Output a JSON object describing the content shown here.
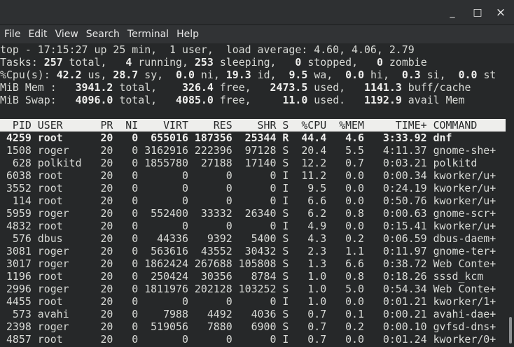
{
  "window": {
    "controls": {
      "minimize": "_",
      "maximize": "□",
      "close": "×"
    }
  },
  "menu": [
    "File",
    "Edit",
    "View",
    "Search",
    "Terminal",
    "Help"
  ],
  "summary": [
    [
      {
        "t": "top - 17:15:27 up 25 min,  1 user,  load average: 4.60, 4.06, 2.79",
        "b": false
      }
    ],
    [
      {
        "t": "Tasks: "
      },
      {
        "t": "257",
        "b": true
      },
      {
        "t": " total,   "
      },
      {
        "t": "4",
        "b": true
      },
      {
        "t": " running, "
      },
      {
        "t": "253",
        "b": true
      },
      {
        "t": " sleeping,   "
      },
      {
        "t": "0",
        "b": true
      },
      {
        "t": " stopped,   "
      },
      {
        "t": "0",
        "b": true
      },
      {
        "t": " zombie"
      }
    ],
    [
      {
        "t": "%Cpu(s): "
      },
      {
        "t": "42.2",
        "b": true
      },
      {
        "t": " us, "
      },
      {
        "t": "28.7",
        "b": true
      },
      {
        "t": " sy,  "
      },
      {
        "t": "0.0",
        "b": true
      },
      {
        "t": " ni, "
      },
      {
        "t": "19.3",
        "b": true
      },
      {
        "t": " id,  "
      },
      {
        "t": "9.5",
        "b": true
      },
      {
        "t": " wa,  "
      },
      {
        "t": "0.0",
        "b": true
      },
      {
        "t": " hi,  "
      },
      {
        "t": "0.3",
        "b": true
      },
      {
        "t": " si,  "
      },
      {
        "t": "0.0",
        "b": true
      },
      {
        "t": " st"
      }
    ],
    [
      {
        "t": "MiB Mem :   "
      },
      {
        "t": "3941.2",
        "b": true
      },
      {
        "t": " total,    "
      },
      {
        "t": "326.4",
        "b": true
      },
      {
        "t": " free,   "
      },
      {
        "t": "2473.5",
        "b": true
      },
      {
        "t": " used,   "
      },
      {
        "t": "1141.3",
        "b": true
      },
      {
        "t": " buff/cache"
      }
    ],
    [
      {
        "t": "MiB Swap:   "
      },
      {
        "t": "4096.0",
        "b": true
      },
      {
        "t": " total,   "
      },
      {
        "t": "4085.0",
        "b": true
      },
      {
        "t": " free,     "
      },
      {
        "t": "11.0",
        "b": true
      },
      {
        "t": " used.   "
      },
      {
        "t": "1192.9",
        "b": true
      },
      {
        "t": " avail Mem"
      }
    ]
  ],
  "columns": [
    "PID",
    "USER",
    "PR",
    "NI",
    "VIRT",
    "RES",
    "SHR",
    "S",
    "%CPU",
    "%MEM",
    "TIME+",
    "COMMAND"
  ],
  "processes": [
    [
      "4259",
      "root",
      "20",
      "0",
      "655016",
      "187356",
      "25344",
      "R",
      "44.4",
      "4.6",
      "3:33.92",
      "dnf",
      true
    ],
    [
      "1508",
      "roger",
      "20",
      "0",
      "3162916",
      "222396",
      "97128",
      "S",
      "20.4",
      "5.5",
      "4:11.37",
      "gnome-she+"
    ],
    [
      "628",
      "polkitd",
      "20",
      "0",
      "1855780",
      "27188",
      "17140",
      "S",
      "12.2",
      "0.7",
      "0:03.21",
      "polkitd"
    ],
    [
      "6038",
      "root",
      "20",
      "0",
      "0",
      "0",
      "0",
      "I",
      "11.2",
      "0.0",
      "0:00.34",
      "kworker/u+"
    ],
    [
      "3552",
      "root",
      "20",
      "0",
      "0",
      "0",
      "0",
      "I",
      "9.5",
      "0.0",
      "0:24.19",
      "kworker/u+"
    ],
    [
      "114",
      "root",
      "20",
      "0",
      "0",
      "0",
      "0",
      "I",
      "6.6",
      "0.0",
      "0:50.76",
      "kworker/u+"
    ],
    [
      "5959",
      "roger",
      "20",
      "0",
      "552400",
      "33332",
      "26340",
      "S",
      "6.2",
      "0.8",
      "0:00.63",
      "gnome-scr+"
    ],
    [
      "4832",
      "root",
      "20",
      "0",
      "0",
      "0",
      "0",
      "I",
      "4.9",
      "0.0",
      "0:15.41",
      "kworker/u+"
    ],
    [
      "576",
      "dbus",
      "20",
      "0",
      "44336",
      "9392",
      "5400",
      "S",
      "4.3",
      "0.2",
      "0:06.59",
      "dbus-daem+"
    ],
    [
      "3081",
      "roger",
      "20",
      "0",
      "563616",
      "43552",
      "30432",
      "S",
      "2.3",
      "1.1",
      "0:11.97",
      "gnome-ter+"
    ],
    [
      "3017",
      "roger",
      "20",
      "0",
      "1862424",
      "267688",
      "105808",
      "S",
      "1.3",
      "6.6",
      "0:38.72",
      "Web Conte+"
    ],
    [
      "1196",
      "root",
      "20",
      "0",
      "250424",
      "30356",
      "8784",
      "S",
      "1.0",
      "0.8",
      "0:18.26",
      "sssd_kcm"
    ],
    [
      "2996",
      "roger",
      "20",
      "0",
      "1811976",
      "202128",
      "103252",
      "S",
      "1.0",
      "5.0",
      "0:54.34",
      "Web Conte+"
    ],
    [
      "4455",
      "root",
      "20",
      "0",
      "0",
      "0",
      "0",
      "I",
      "1.0",
      "0.0",
      "0:01.21",
      "kworker/1+"
    ],
    [
      "573",
      "avahi",
      "20",
      "0",
      "7988",
      "4492",
      "4036",
      "S",
      "0.7",
      "0.1",
      "0:00.21",
      "avahi-dae+"
    ],
    [
      "2398",
      "roger",
      "20",
      "0",
      "519056",
      "7880",
      "6900",
      "S",
      "0.7",
      "0.2",
      "0:00.10",
      "gvfsd-dns+"
    ],
    [
      "4857",
      "root",
      "20",
      "0",
      "0",
      "0",
      "0",
      "I",
      "0.7",
      "0.0",
      "0:01.24",
      "kworker/0+"
    ]
  ]
}
